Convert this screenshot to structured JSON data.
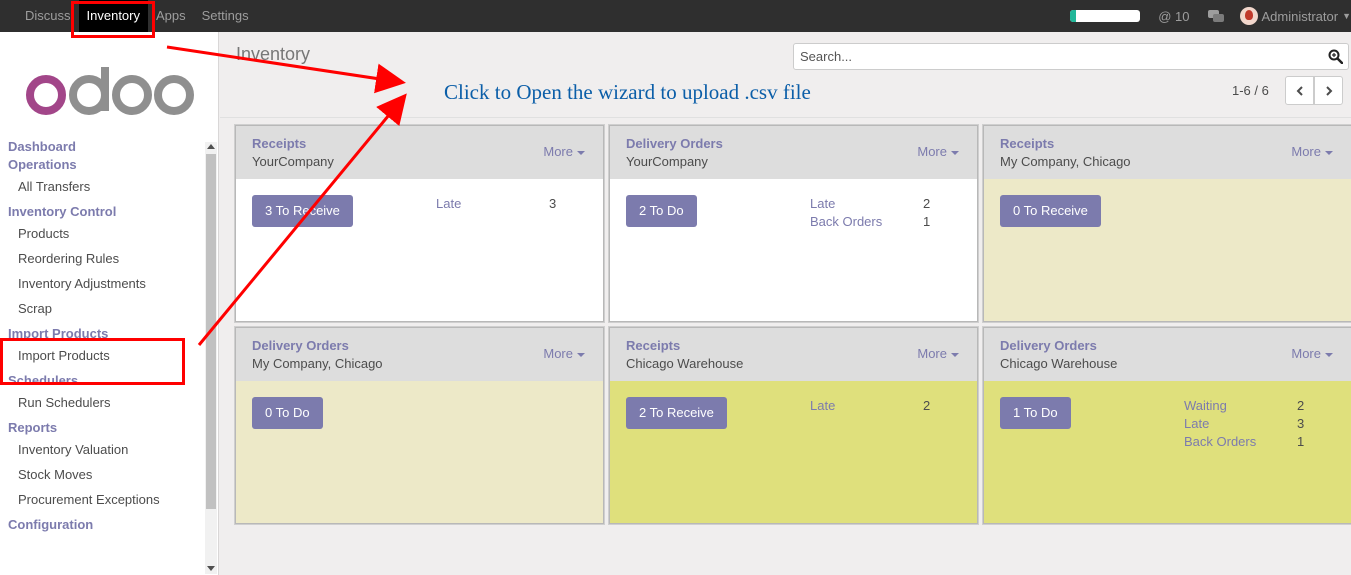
{
  "topbar": {
    "menu": [
      "Discuss",
      "Inventory",
      "Apps",
      "Settings"
    ],
    "active": "Inventory",
    "progress_fraction": 0.08,
    "mentions_count": "10",
    "user_name": "Administrator"
  },
  "logo_text": "odoo",
  "sidebar": {
    "sections": [
      {
        "title": "Dashboard\nOperations",
        "items": [
          "All Transfers"
        ]
      },
      {
        "title": "Inventory Control",
        "items": [
          "Products",
          "Reordering Rules",
          "Inventory Adjustments",
          "Scrap"
        ]
      },
      {
        "title": "Import Products",
        "items": [
          "Import Products"
        ]
      },
      {
        "title": "Schedulers",
        "items": [
          "Run Schedulers"
        ]
      },
      {
        "title": "Reports",
        "items": [
          "Inventory Valuation",
          "Stock Moves",
          "Procurement Exceptions"
        ]
      },
      {
        "title": "Configuration",
        "items": []
      }
    ]
  },
  "control_panel": {
    "title": "Inventory",
    "search_placeholder": "Search...",
    "pager": "1-6 / 6"
  },
  "annotation_text": "Click to Open the wizard  to upload .csv file",
  "more_label": "More",
  "cards": [
    {
      "title": "Receipts",
      "warehouse": "YourCompany",
      "button": "3 To Receive",
      "stats": [
        {
          "label": "Late",
          "value": "3"
        }
      ],
      "tint": "white"
    },
    {
      "title": "Delivery Orders",
      "warehouse": "YourCompany",
      "button": "2 To Do",
      "stats": [
        {
          "label": "Late",
          "value": "2"
        },
        {
          "label": "Back Orders",
          "value": "1"
        }
      ],
      "tint": "white"
    },
    {
      "title": "Receipts",
      "warehouse": "My Company, Chicago",
      "button": "0 To Receive",
      "stats": [],
      "tint": "beige"
    },
    {
      "title": "Delivery Orders",
      "warehouse": "My Company, Chicago",
      "button": "0 To Do",
      "stats": [],
      "tint": "beige"
    },
    {
      "title": "Receipts",
      "warehouse": "Chicago Warehouse",
      "button": "2 To Receive",
      "stats": [
        {
          "label": "Late",
          "value": "2"
        }
      ],
      "tint": "green"
    },
    {
      "title": "Delivery Orders",
      "warehouse": "Chicago Warehouse",
      "button": "1 To Do",
      "stats": [
        {
          "label": "Waiting",
          "value": "2"
        },
        {
          "label": "Late",
          "value": "3"
        },
        {
          "label": "Back Orders",
          "value": "1"
        }
      ],
      "tint": "green"
    }
  ],
  "colors": {
    "topbar": "#2f2f2f",
    "accent": "#7c7bad",
    "annotation": "#ff0000",
    "card_beige": "#ede9c8",
    "card_green": "#dfe07c"
  }
}
